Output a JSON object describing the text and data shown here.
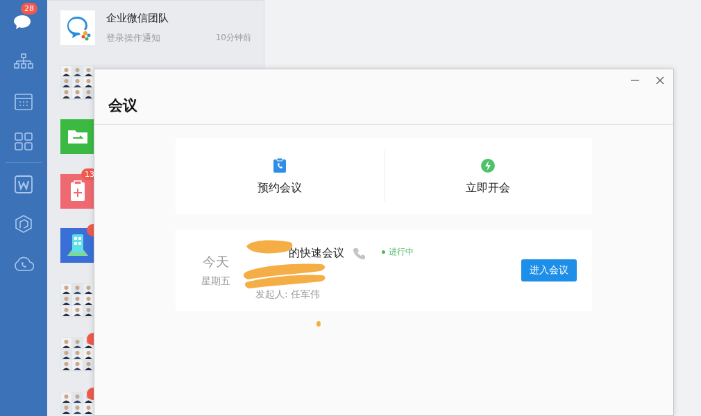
{
  "nav": [
    {
      "kind": "chat",
      "selected": true,
      "badge": "28"
    },
    {
      "kind": "org",
      "selected": false
    },
    {
      "kind": "calendar",
      "selected": false
    },
    {
      "kind": "apps",
      "selected": false
    },
    {
      "kind": "divider"
    },
    {
      "kind": "doc",
      "selected": false
    },
    {
      "kind": "cube",
      "selected": false
    },
    {
      "kind": "cloud",
      "selected": false
    }
  ],
  "chats": [
    {
      "kind": "logo",
      "name": "企业微信团队",
      "preview": "登录操作通知",
      "time": "10分钟前"
    },
    {
      "kind": "group"
    },
    {
      "kind": "folder"
    },
    {
      "kind": "clipboard",
      "badge": "13"
    },
    {
      "kind": "building",
      "dot": true
    },
    {
      "kind": "group"
    },
    {
      "kind": "group",
      "dot": true
    },
    {
      "kind": "group",
      "dot": true
    }
  ],
  "dialog": {
    "title": "会议",
    "actions": [
      {
        "kind": "schedule",
        "label": "预约会议"
      },
      {
        "kind": "instant",
        "label": "立即开会"
      }
    ],
    "meetings": [
      {
        "day": "今天",
        "weekday": "星期五",
        "title": "的快速会议",
        "status": "进行中",
        "live": true,
        "organizer": "发起人: 任军伟",
        "button": "进入会议"
      }
    ]
  }
}
